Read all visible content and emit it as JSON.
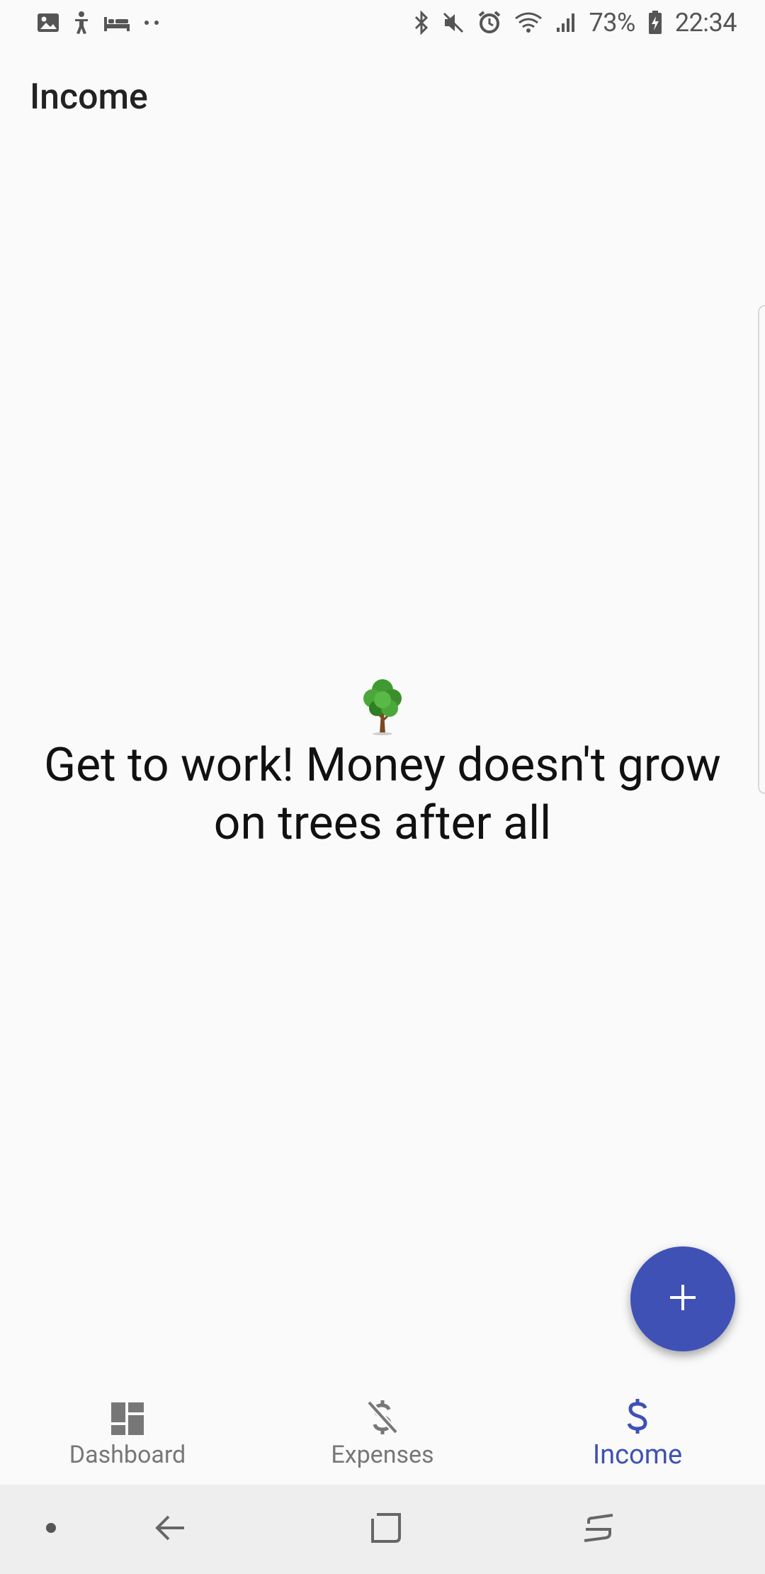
{
  "status_bar": {
    "battery_percent": "73%",
    "time": "22:34",
    "left_icons": [
      "gallery-icon",
      "accessibility-icon",
      "bed-icon",
      "more-dots-icon"
    ],
    "right_icons": [
      "bluetooth-icon",
      "mute-icon",
      "alarm-icon",
      "wifi-icon",
      "signal-icon",
      "battery-charging-icon"
    ]
  },
  "header": {
    "title": "Income"
  },
  "empty_state": {
    "icon": "tree-icon",
    "message": "Get to work! Money doesn't grow on trees after all"
  },
  "fab": {
    "icon": "plus-icon",
    "color": "#3f51b5"
  },
  "bottom_nav": {
    "items": [
      {
        "label": "Dashboard",
        "icon": "dashboard-icon",
        "active": false
      },
      {
        "label": "Expenses",
        "icon": "money-off-icon",
        "active": false
      },
      {
        "label": "Income",
        "icon": "dollar-icon",
        "active": true
      }
    ],
    "active_color": "#3f51b5"
  },
  "system_nav": {
    "buttons": [
      "dot-icon",
      "back-icon",
      "recents-icon",
      "switch-icon"
    ]
  }
}
